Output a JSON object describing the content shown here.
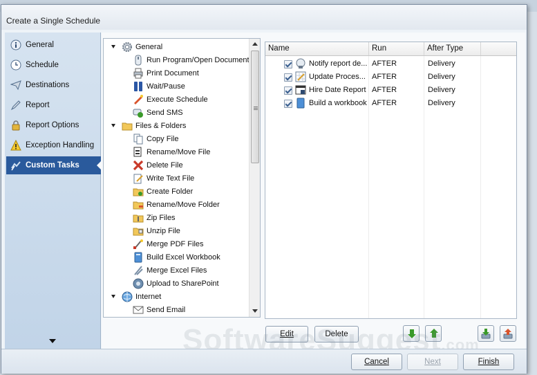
{
  "window": {
    "title": "Create a Single Schedule"
  },
  "sidebar": {
    "items": [
      {
        "label": "General",
        "icon": "info-icon",
        "active": false
      },
      {
        "label": "Schedule",
        "icon": "clock-icon",
        "active": false
      },
      {
        "label": "Destinations",
        "icon": "send-icon",
        "active": false
      },
      {
        "label": "Report",
        "icon": "pen-icon",
        "active": false
      },
      {
        "label": "Report Options",
        "icon": "lock-icon",
        "active": false
      },
      {
        "label": "Exception Handling",
        "icon": "warning-icon",
        "active": false
      },
      {
        "label": "Custom Tasks",
        "icon": "tasks-icon",
        "active": true
      }
    ]
  },
  "tree": {
    "groups": [
      {
        "label": "General",
        "icon": "gear-icon",
        "items": [
          {
            "label": "Run Program/Open Document",
            "icon": "run-program-icon"
          },
          {
            "label": "Print Document",
            "icon": "printer-icon"
          },
          {
            "label": "Wait/Pause",
            "icon": "pause-icon"
          },
          {
            "label": "Execute Schedule",
            "icon": "execute-icon"
          },
          {
            "label": "Send SMS",
            "icon": "sms-icon"
          }
        ]
      },
      {
        "label": "Files & Folders",
        "icon": "folder-icon",
        "items": [
          {
            "label": "Copy File",
            "icon": "copy-file-icon"
          },
          {
            "label": "Rename/Move File",
            "icon": "rename-file-icon"
          },
          {
            "label": "Delete File",
            "icon": "delete-x-icon"
          },
          {
            "label": "Write Text File",
            "icon": "write-text-icon"
          },
          {
            "label": "Create Folder",
            "icon": "create-folder-icon"
          },
          {
            "label": "Rename/Move Folder",
            "icon": "rename-folder-icon"
          },
          {
            "label": "Zip Files",
            "icon": "zip-icon"
          },
          {
            "label": "Unzip File",
            "icon": "unzip-icon"
          },
          {
            "label": "Merge PDF Files",
            "icon": "merge-pdf-icon"
          },
          {
            "label": "Build Excel Workbook",
            "icon": "excel-workbook-icon"
          },
          {
            "label": "Merge Excel Files",
            "icon": "merge-excel-icon"
          },
          {
            "label": "Upload to SharePoint",
            "icon": "sharepoint-icon"
          }
        ]
      },
      {
        "label": "Internet",
        "icon": "globe-icon",
        "items": [
          {
            "label": "Send Email",
            "icon": "email-icon"
          }
        ]
      }
    ]
  },
  "tasks": {
    "columns": [
      "Name",
      "Run",
      "After Type"
    ],
    "rows": [
      {
        "checked": true,
        "name": "Notify report de...",
        "run": "AFTER",
        "after_type": "Delivery",
        "icon": "notify-icon"
      },
      {
        "checked": true,
        "name": "Update Proces...",
        "run": "AFTER",
        "after_type": "Delivery",
        "icon": "update-icon"
      },
      {
        "checked": true,
        "name": "Hire Date Report",
        "run": "AFTER",
        "after_type": "Delivery",
        "icon": "report-icon"
      },
      {
        "checked": true,
        "name": "Build a workbook",
        "run": "AFTER",
        "after_type": "Delivery",
        "icon": "workbook-icon"
      }
    ]
  },
  "buttons": {
    "edit": "Edit",
    "delete": "Delete",
    "cancel": "Cancel",
    "next": "Next",
    "finish": "Finish"
  },
  "watermark": {
    "text": "SoftwareSuggest",
    "suffix": ".com"
  },
  "colors": {
    "accent": "#2a5a9c",
    "sidebar": "#c9daeb",
    "move_arrow": "#3a9a2a"
  }
}
